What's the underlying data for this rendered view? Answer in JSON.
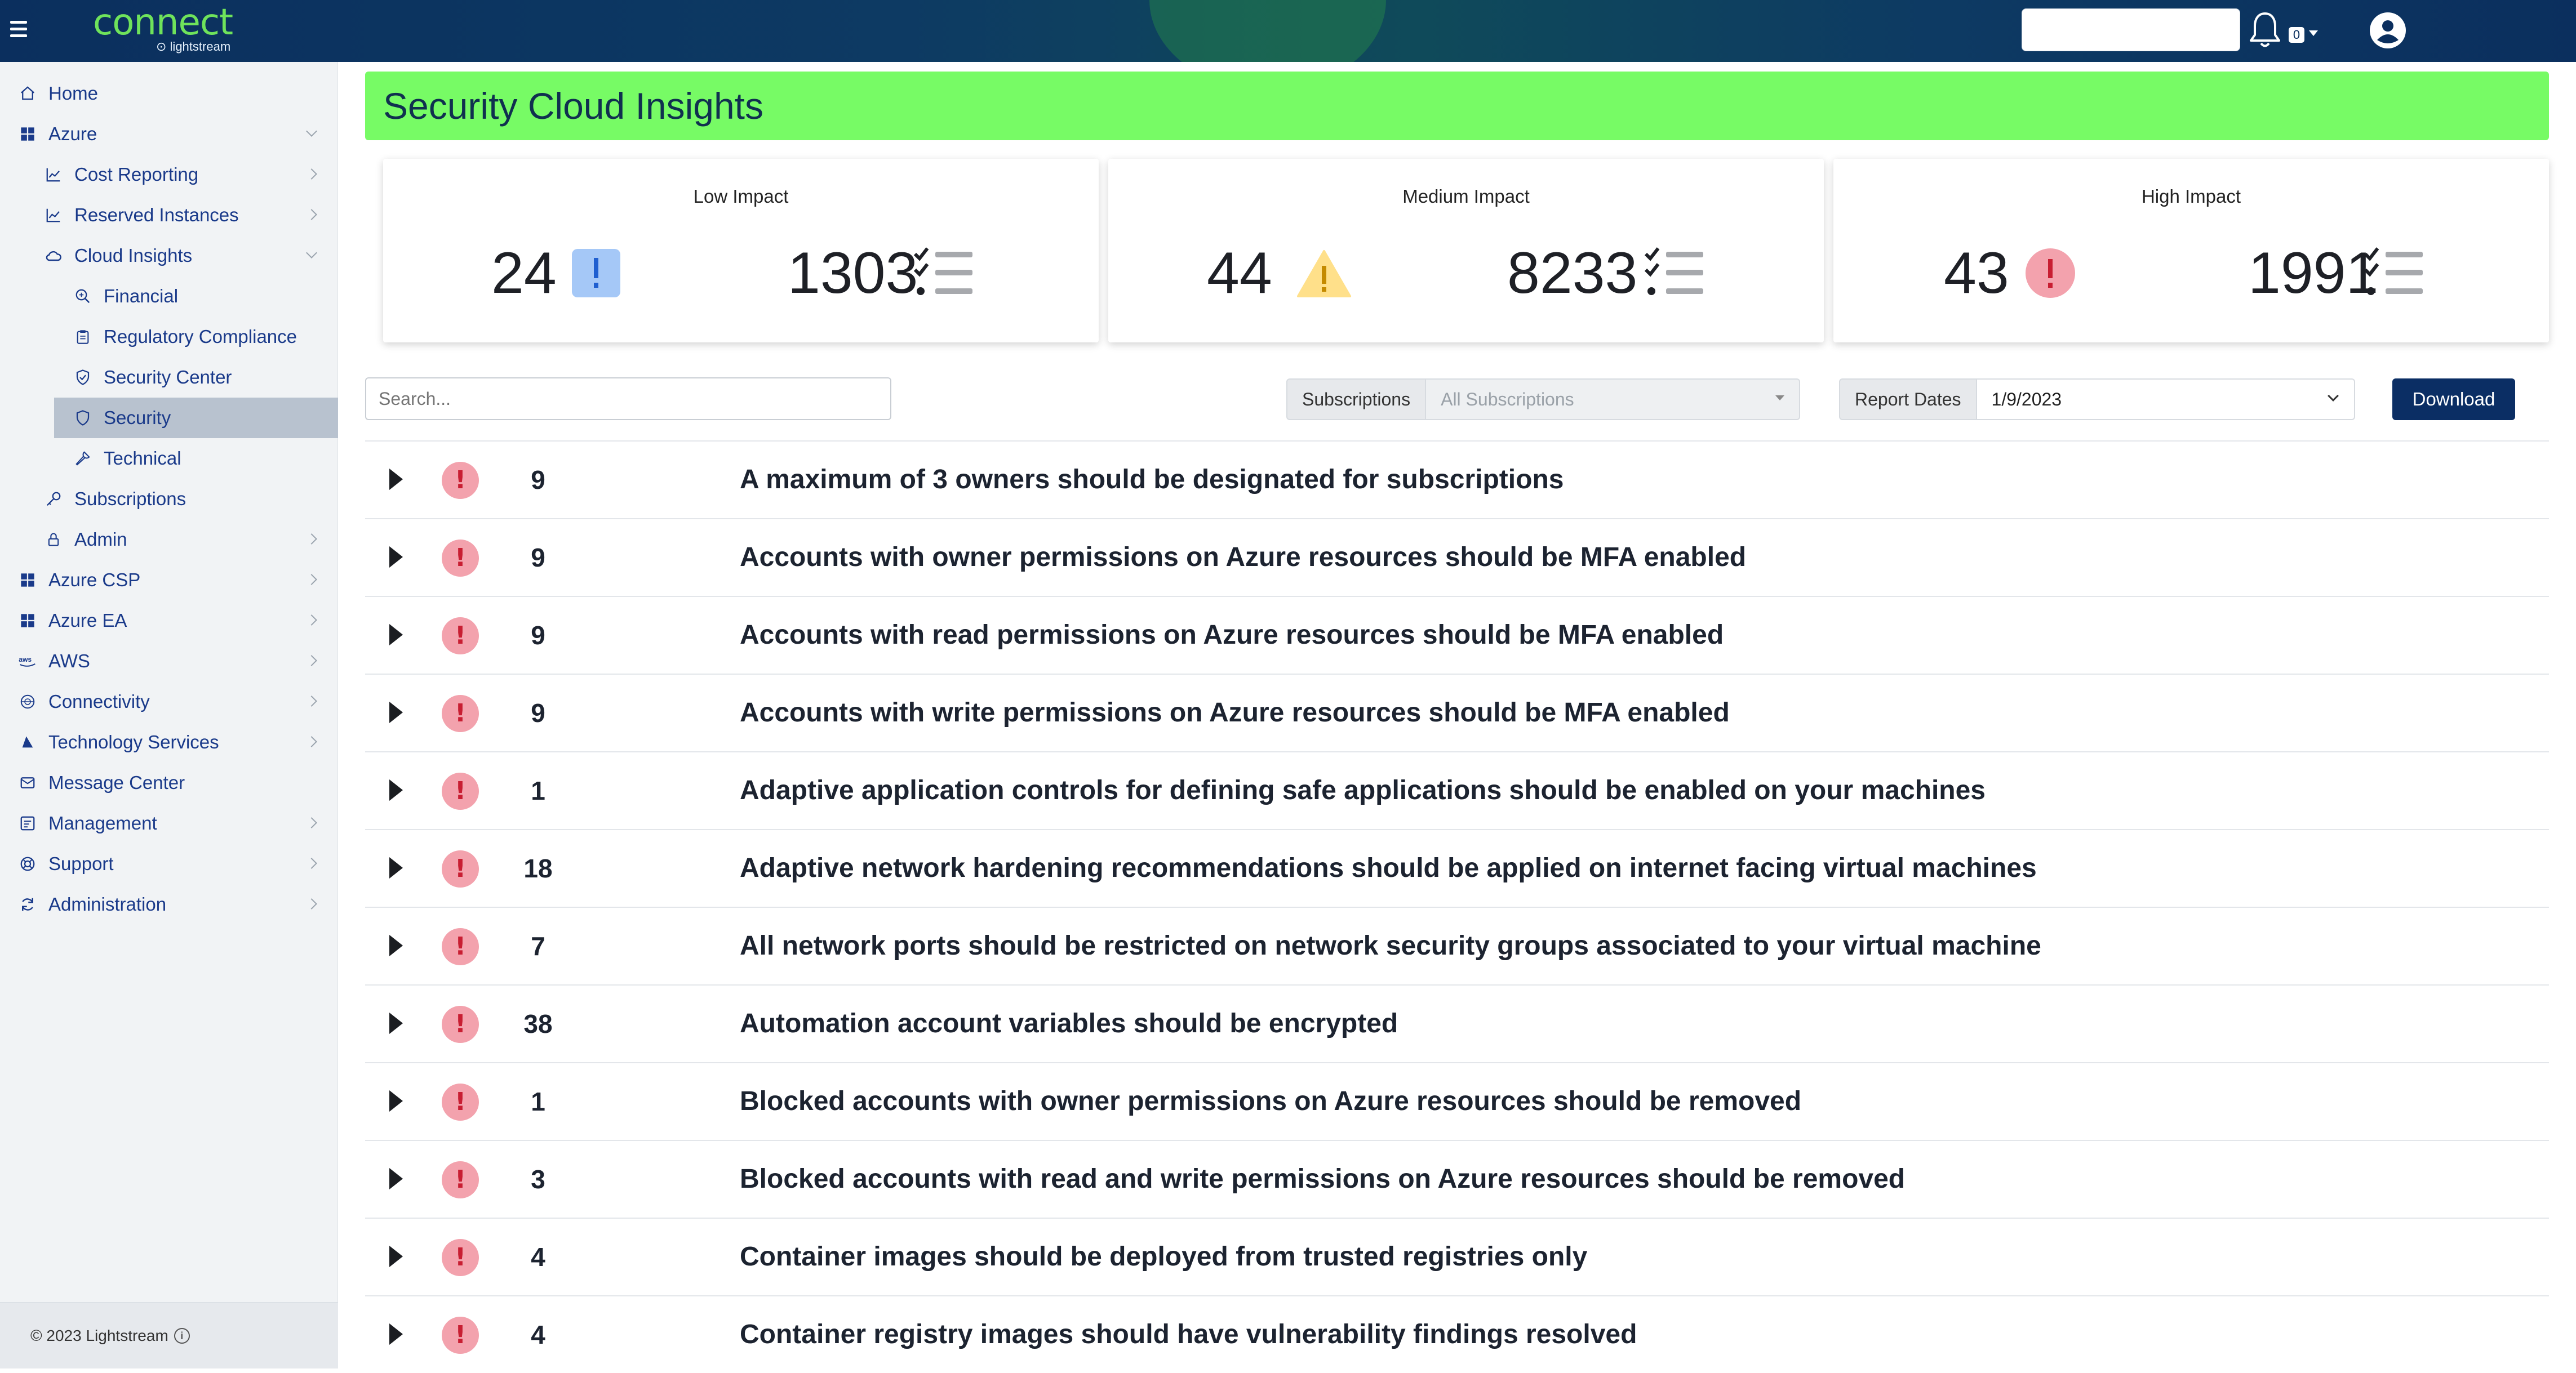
{
  "header": {
    "logo_text": "connect",
    "logo_sub": "lightstream",
    "notification_count": "0"
  },
  "sidebar": {
    "items": [
      {
        "label": "Home",
        "icon": "home-icon",
        "level": 0
      },
      {
        "label": "Azure",
        "icon": "windows-icon",
        "level": 0,
        "expanded": true
      },
      {
        "label": "Cost Reporting",
        "icon": "chart-icon",
        "level": 1
      },
      {
        "label": "Reserved Instances",
        "icon": "chart-icon",
        "level": 1
      },
      {
        "label": "Cloud Insights",
        "icon": "cloud-icon",
        "level": 1,
        "expanded": true
      },
      {
        "label": "Financial",
        "icon": "magnifier-icon",
        "level": 2
      },
      {
        "label": "Regulatory Compliance",
        "icon": "clipboard-icon",
        "level": 2
      },
      {
        "label": "Security Center",
        "icon": "shield-check-icon",
        "level": 2
      },
      {
        "label": "Security",
        "icon": "shield-icon",
        "level": 2,
        "active": true
      },
      {
        "label": "Technical",
        "icon": "wrench-icon",
        "level": 2
      },
      {
        "label": "Subscriptions",
        "icon": "key-icon",
        "level": 1
      },
      {
        "label": "Admin",
        "icon": "lock-icon",
        "level": 1
      },
      {
        "label": "Azure CSP",
        "icon": "windows-icon",
        "level": 0
      },
      {
        "label": "Azure EA",
        "icon": "windows-icon",
        "level": 0
      },
      {
        "label": "AWS",
        "icon": "aws-icon",
        "level": 0
      },
      {
        "label": "Connectivity",
        "icon": "globe-icon",
        "level": 0
      },
      {
        "label": "Technology Services",
        "icon": "sail-icon",
        "level": 0
      },
      {
        "label": "Message Center",
        "icon": "mail-icon",
        "level": 0
      },
      {
        "label": "Management",
        "icon": "dashboard-icon",
        "level": 0
      },
      {
        "label": "Support",
        "icon": "lifebuoy-icon",
        "level": 0
      },
      {
        "label": "Administration",
        "icon": "refresh-icon",
        "level": 0
      }
    ],
    "footer": "© 2023 Lightstream"
  },
  "page": {
    "title": "Security Cloud Insights"
  },
  "cards": [
    {
      "title": "Low Impact",
      "count": "24",
      "total": "1303",
      "color": "#a5c8f7"
    },
    {
      "title": "Medium Impact",
      "count": "44",
      "total": "8233",
      "color": "#ffe08a"
    },
    {
      "title": "High Impact",
      "count": "43",
      "total": "1991",
      "color": "#f3a2ad"
    }
  ],
  "filters": {
    "search_placeholder": "Search...",
    "subscriptions_label": "Subscriptions",
    "subscriptions_value": "All Subscriptions",
    "report_dates_label": "Report Dates",
    "report_dates_value": "1/9/2023",
    "download_label": "Download"
  },
  "recommendations": [
    {
      "count": "9",
      "text": "A maximum of 3 owners should be designated for subscriptions"
    },
    {
      "count": "9",
      "text": "Accounts with owner permissions on Azure resources should be MFA enabled"
    },
    {
      "count": "9",
      "text": "Accounts with read permissions on Azure resources should be MFA enabled"
    },
    {
      "count": "9",
      "text": "Accounts with write permissions on Azure resources should be MFA enabled"
    },
    {
      "count": "1",
      "text": "Adaptive application controls for defining safe applications should be enabled on your machines"
    },
    {
      "count": "18",
      "text": "Adaptive network hardening recommendations should be applied on internet facing virtual machines"
    },
    {
      "count": "7",
      "text": "All network ports should be restricted on network security groups associated to your virtual machine"
    },
    {
      "count": "38",
      "text": "Automation account variables should be encrypted"
    },
    {
      "count": "1",
      "text": "Blocked accounts with owner permissions on Azure resources should be removed"
    },
    {
      "count": "3",
      "text": "Blocked accounts with read and write permissions on Azure resources should be removed"
    },
    {
      "count": "4",
      "text": "Container images should be deployed from trusted registries only"
    },
    {
      "count": "4",
      "text": "Container registry images should have vulnerability findings resolved"
    }
  ]
}
